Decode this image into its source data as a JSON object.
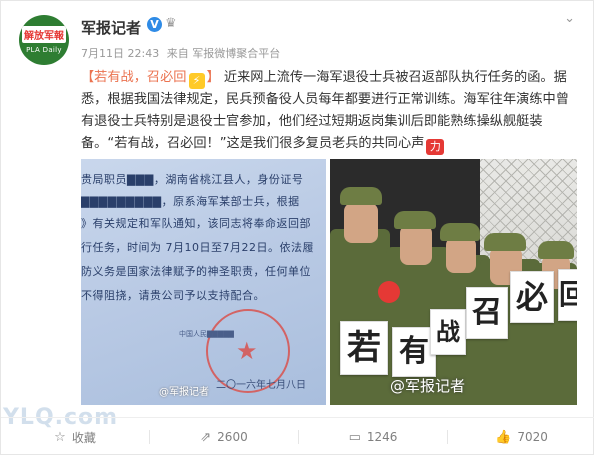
{
  "post": {
    "author": "军报记者",
    "time": "7月11日 22:43",
    "source_prefix": "来自",
    "source": "军报微博聚合平台",
    "avatar_cn": "解放军報",
    "avatar_en": "PLA Daily",
    "text_tag": "【若有战，召必回",
    "text_tag_close": "】",
    "text_body": "近来网上流传一海军退役士兵被召返部队执行任务的函。据悉，根据我国法律规定，民兵预备役人员每年都要进行正常训练。海军往年演练中曾有退役士兵特别是退役士官参加，他们经过短期返岗集训后即能熟练操纵舰艇装备。“若有战，召必回！”这是我们很多复员老兵的共同心声",
    "emoji_li": "力"
  },
  "photo_left": {
    "lines": [
      "贵局职员▇▇▇，湖南省桃江县人，身份证号",
      "▇▇▇▇▇▇▇▇▇，原系海军某部士兵，根据",
      "》有关规定和军队通知，该同志将奉命返回部",
      "行任务，时间为 7月10日至7月22日。依法履",
      "防义务是国家法律赋予的神圣职责，任何单位",
      "不得阻挠，请贵公司予以支持配合。"
    ],
    "stamp_text": "中国人民▇▇▇▇▇",
    "date": "二〇一六年七月八日",
    "watermark": "@军报记者"
  },
  "photo_right": {
    "signs": [
      "若",
      "有",
      "战",
      "召",
      "必",
      "回"
    ],
    "watermark": "@军报记者"
  },
  "actions": {
    "favorite_label": "收藏",
    "repost_count": "2600",
    "comment_count": "1246",
    "like_count": "7020"
  },
  "watermark_site": "YLQ.com"
}
